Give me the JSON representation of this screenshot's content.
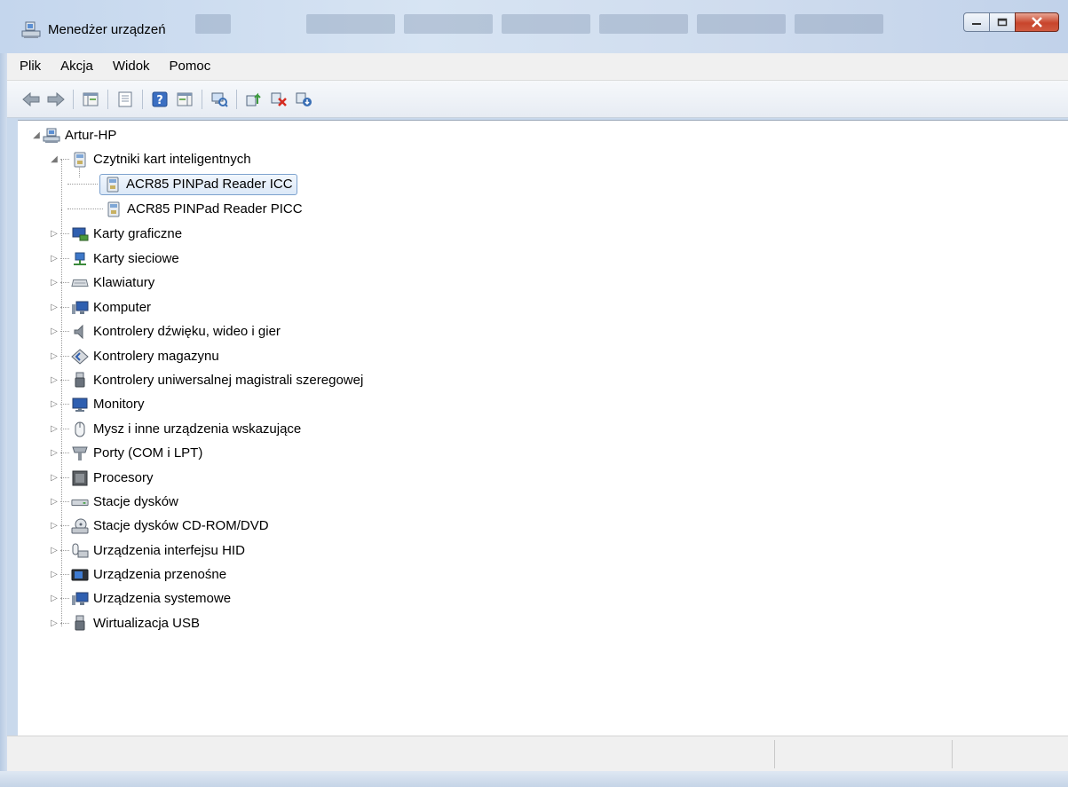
{
  "window": {
    "title": "Menedżer urządzeń",
    "colors": {
      "close": "#c8452c",
      "selection": "#dbe8f7"
    }
  },
  "menu": [
    "Plik",
    "Akcja",
    "Widok",
    "Pomoc"
  ],
  "toolbar": {
    "icons": [
      "back-arrow-icon",
      "forward-arrow-icon",
      "properties-grid-icon",
      "document-icon",
      "help-icon",
      "console-tree-icon",
      "scan-hardware-icon",
      "update-driver-icon",
      "disable-device-icon",
      "uninstall-device-icon"
    ]
  },
  "tree": {
    "root": "Artur-HP",
    "smartcard_category": "Czytniki kart inteligentnych",
    "smartcard_children": [
      "ACR85 PINPad Reader ICC",
      "ACR85 PINPad Reader PICC"
    ],
    "categories": [
      "Karty graficzne",
      "Karty sieciowe",
      "Klawiatury",
      "Komputer",
      "Kontrolery dźwięku, wideo i gier",
      "Kontrolery magazynu",
      "Kontrolery uniwersalnej magistrali szeregowej",
      "Monitory",
      "Mysz i inne urządzenia wskazujące",
      "Porty (COM i LPT)",
      "Procesory",
      "Stacje dysków",
      "Stacje dysków CD-ROM/DVD",
      "Urządzenia interfejsu HID",
      "Urządzenia przenośne",
      "Urządzenia systemowe",
      "Wirtualizacja USB"
    ]
  }
}
